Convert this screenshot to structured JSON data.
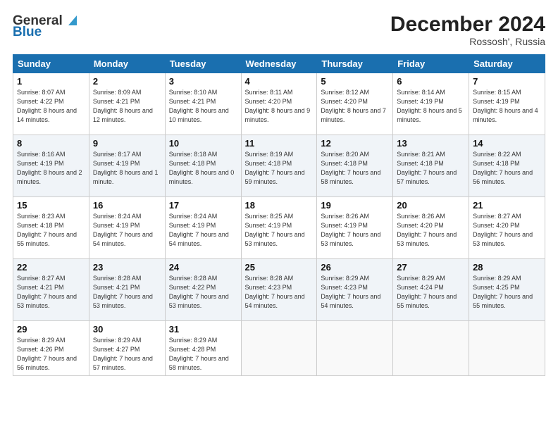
{
  "header": {
    "logo_line1": "General",
    "logo_line2": "Blue",
    "month": "December 2024",
    "location": "Rossosh', Russia"
  },
  "days_of_week": [
    "Sunday",
    "Monday",
    "Tuesday",
    "Wednesday",
    "Thursday",
    "Friday",
    "Saturday"
  ],
  "weeks": [
    [
      {
        "day": "1",
        "sunrise": "8:07 AM",
        "sunset": "4:22 PM",
        "daylight": "8 hours and 14 minutes."
      },
      {
        "day": "2",
        "sunrise": "8:09 AM",
        "sunset": "4:21 PM",
        "daylight": "8 hours and 12 minutes."
      },
      {
        "day": "3",
        "sunrise": "8:10 AM",
        "sunset": "4:21 PM",
        "daylight": "8 hours and 10 minutes."
      },
      {
        "day": "4",
        "sunrise": "8:11 AM",
        "sunset": "4:20 PM",
        "daylight": "8 hours and 9 minutes."
      },
      {
        "day": "5",
        "sunrise": "8:12 AM",
        "sunset": "4:20 PM",
        "daylight": "8 hours and 7 minutes."
      },
      {
        "day": "6",
        "sunrise": "8:14 AM",
        "sunset": "4:19 PM",
        "daylight": "8 hours and 5 minutes."
      },
      {
        "day": "7",
        "sunrise": "8:15 AM",
        "sunset": "4:19 PM",
        "daylight": "8 hours and 4 minutes."
      }
    ],
    [
      {
        "day": "8",
        "sunrise": "8:16 AM",
        "sunset": "4:19 PM",
        "daylight": "8 hours and 2 minutes."
      },
      {
        "day": "9",
        "sunrise": "8:17 AM",
        "sunset": "4:19 PM",
        "daylight": "8 hours and 1 minute."
      },
      {
        "day": "10",
        "sunrise": "8:18 AM",
        "sunset": "4:18 PM",
        "daylight": "8 hours and 0 minutes."
      },
      {
        "day": "11",
        "sunrise": "8:19 AM",
        "sunset": "4:18 PM",
        "daylight": "7 hours and 59 minutes."
      },
      {
        "day": "12",
        "sunrise": "8:20 AM",
        "sunset": "4:18 PM",
        "daylight": "7 hours and 58 minutes."
      },
      {
        "day": "13",
        "sunrise": "8:21 AM",
        "sunset": "4:18 PM",
        "daylight": "7 hours and 57 minutes."
      },
      {
        "day": "14",
        "sunrise": "8:22 AM",
        "sunset": "4:18 PM",
        "daylight": "7 hours and 56 minutes."
      }
    ],
    [
      {
        "day": "15",
        "sunrise": "8:23 AM",
        "sunset": "4:18 PM",
        "daylight": "7 hours and 55 minutes."
      },
      {
        "day": "16",
        "sunrise": "8:24 AM",
        "sunset": "4:19 PM",
        "daylight": "7 hours and 54 minutes."
      },
      {
        "day": "17",
        "sunrise": "8:24 AM",
        "sunset": "4:19 PM",
        "daylight": "7 hours and 54 minutes."
      },
      {
        "day": "18",
        "sunrise": "8:25 AM",
        "sunset": "4:19 PM",
        "daylight": "7 hours and 53 minutes."
      },
      {
        "day": "19",
        "sunrise": "8:26 AM",
        "sunset": "4:19 PM",
        "daylight": "7 hours and 53 minutes."
      },
      {
        "day": "20",
        "sunrise": "8:26 AM",
        "sunset": "4:20 PM",
        "daylight": "7 hours and 53 minutes."
      },
      {
        "day": "21",
        "sunrise": "8:27 AM",
        "sunset": "4:20 PM",
        "daylight": "7 hours and 53 minutes."
      }
    ],
    [
      {
        "day": "22",
        "sunrise": "8:27 AM",
        "sunset": "4:21 PM",
        "daylight": "7 hours and 53 minutes."
      },
      {
        "day": "23",
        "sunrise": "8:28 AM",
        "sunset": "4:21 PM",
        "daylight": "7 hours and 53 minutes."
      },
      {
        "day": "24",
        "sunrise": "8:28 AM",
        "sunset": "4:22 PM",
        "daylight": "7 hours and 53 minutes."
      },
      {
        "day": "25",
        "sunrise": "8:28 AM",
        "sunset": "4:23 PM",
        "daylight": "7 hours and 54 minutes."
      },
      {
        "day": "26",
        "sunrise": "8:29 AM",
        "sunset": "4:23 PM",
        "daylight": "7 hours and 54 minutes."
      },
      {
        "day": "27",
        "sunrise": "8:29 AM",
        "sunset": "4:24 PM",
        "daylight": "7 hours and 55 minutes."
      },
      {
        "day": "28",
        "sunrise": "8:29 AM",
        "sunset": "4:25 PM",
        "daylight": "7 hours and 55 minutes."
      }
    ],
    [
      {
        "day": "29",
        "sunrise": "8:29 AM",
        "sunset": "4:26 PM",
        "daylight": "7 hours and 56 minutes."
      },
      {
        "day": "30",
        "sunrise": "8:29 AM",
        "sunset": "4:27 PM",
        "daylight": "7 hours and 57 minutes."
      },
      {
        "day": "31",
        "sunrise": "8:29 AM",
        "sunset": "4:28 PM",
        "daylight": "7 hours and 58 minutes."
      },
      null,
      null,
      null,
      null
    ]
  ]
}
